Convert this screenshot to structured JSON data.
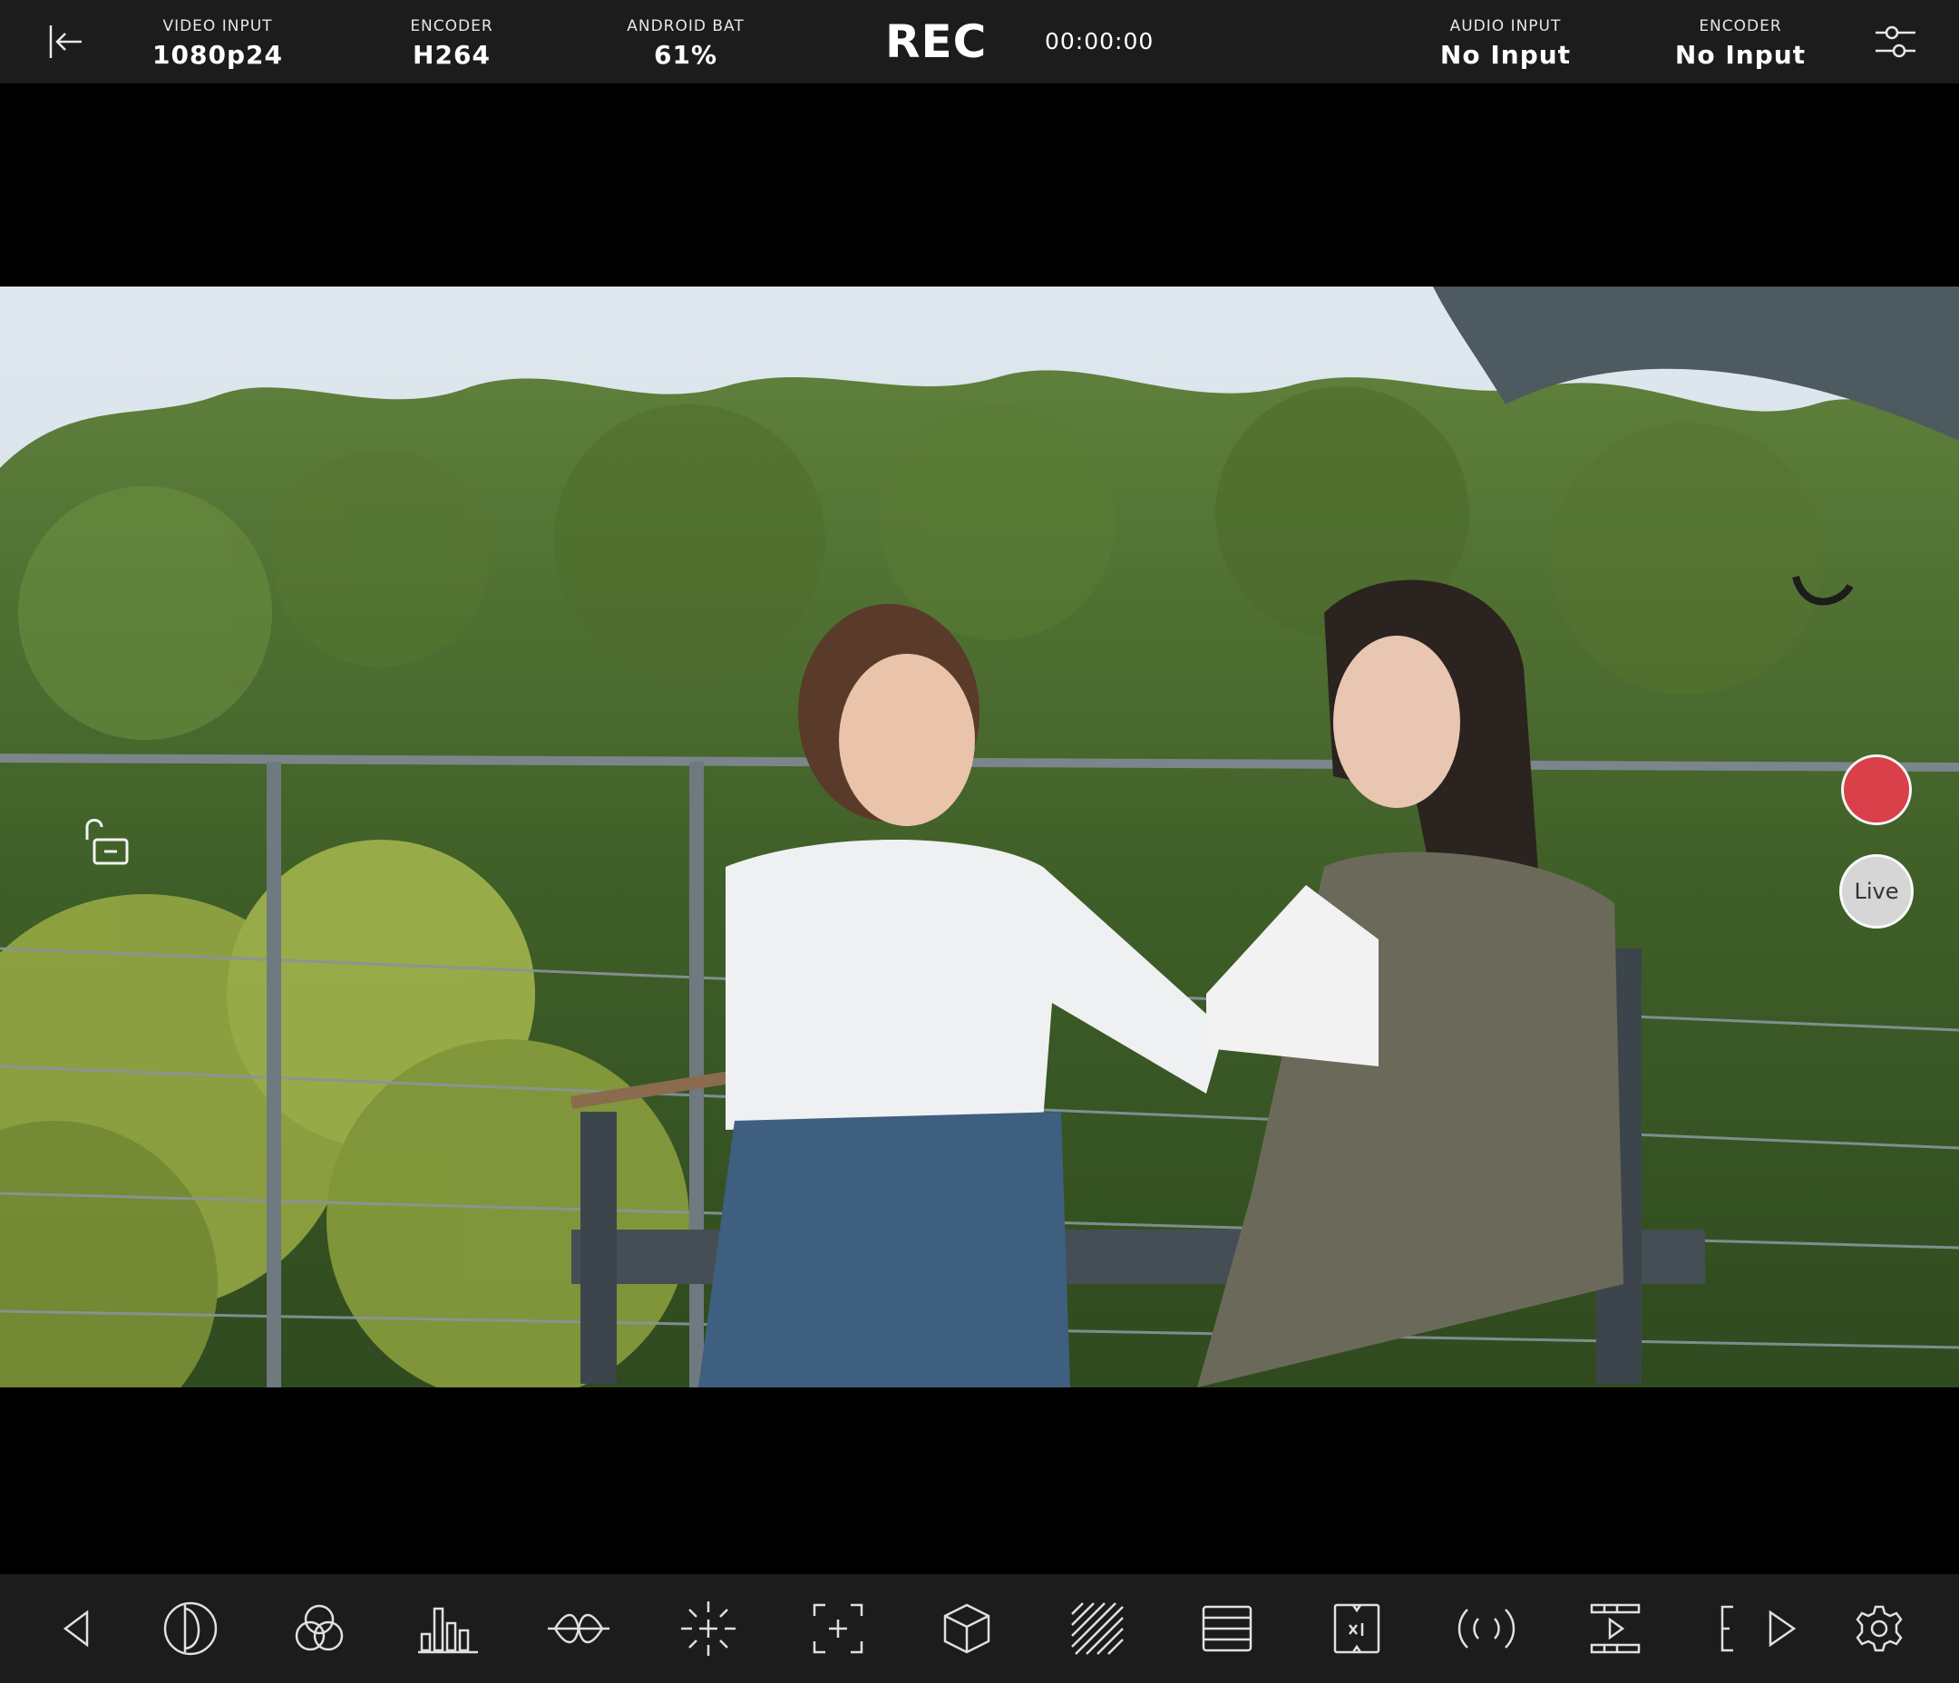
{
  "topbar": {
    "back_icon": "exit-arrow-icon",
    "video_input": {
      "label": "VIDEO INPUT",
      "value": "1080p24"
    },
    "encoder_video": {
      "label": "ENCODER",
      "value": "H264"
    },
    "battery": {
      "label": "ANDROID BAT",
      "value": "61%"
    },
    "rec_label": "REC",
    "timecode": "00:00:00",
    "audio_input": {
      "label": "AUDIO INPUT",
      "value": "No Input"
    },
    "encoder_audio": {
      "label": "ENCODER",
      "value": "No Input"
    },
    "settings_icon": "sliders-icon"
  },
  "viewport": {
    "lock_icon": "unlock-icon",
    "record_button_color": "#d9404a",
    "live_label": "Live"
  },
  "toolbar": {
    "icons": [
      "chevron-left-icon",
      "false-color-icon",
      "rgb-circles-icon",
      "histogram-icon",
      "waveform-icon",
      "peaking-icon",
      "focus-frame-icon",
      "lut-cube-icon",
      "zebra-icon",
      "lines-icon",
      "anamorphic-x1-icon",
      "audio-wave-icon",
      "playback-icon",
      "bracket-icon",
      "play-icon",
      "gear-icon"
    ]
  }
}
